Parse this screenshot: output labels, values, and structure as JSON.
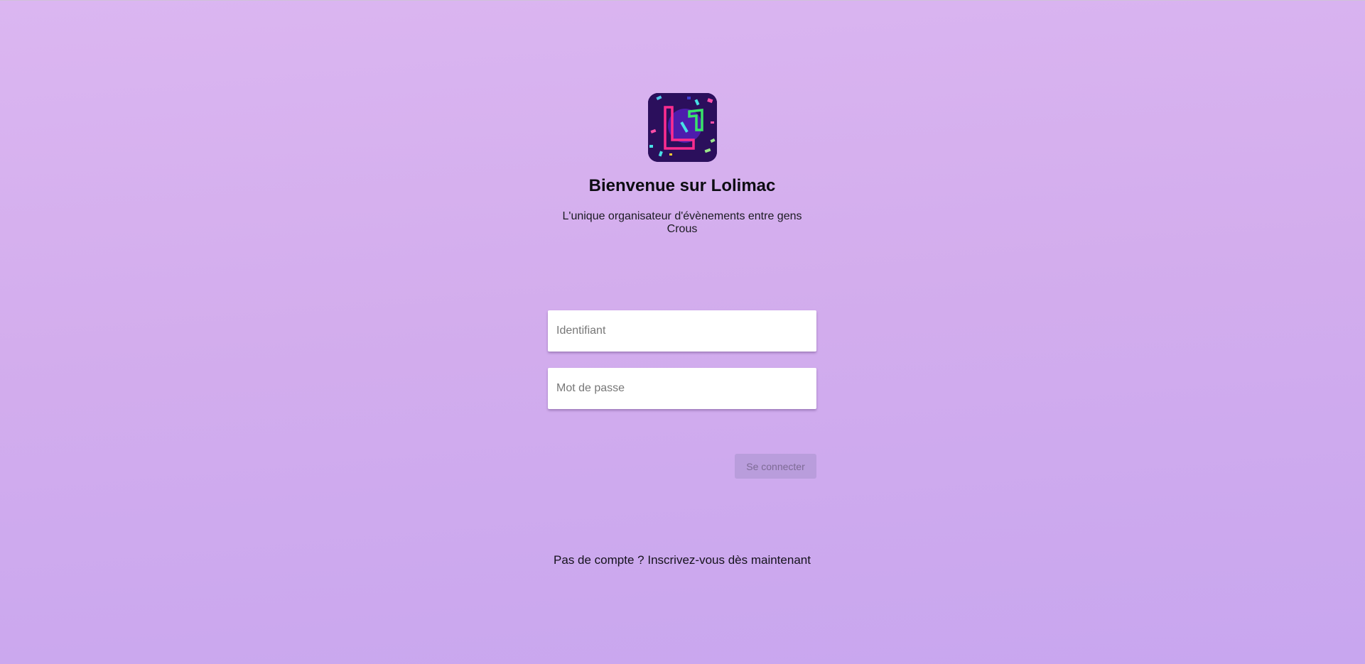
{
  "app": {
    "logo_letters": "L",
    "title": "Bienvenue sur Lolimac",
    "subtitle": "L'unique organisateur d'évènements entre gens Crous"
  },
  "login_form": {
    "username_placeholder": "Identifiant",
    "username_value": "",
    "password_placeholder": "Mot de passe",
    "password_value": "",
    "submit_label": "Se connecter",
    "submit_disabled": true
  },
  "register": {
    "prefix": "Pas de compte ? ",
    "link_label": "Inscrivez-vous dès maintenant"
  },
  "icons": {
    "logo": "lolimac-logo-icon"
  },
  "colors": {
    "background_top": "#dbb6f1",
    "background_bottom": "#c8a6ef",
    "logo_background": "#2b0f5c",
    "logo_pink": "#ff2d8f",
    "logo_green": "#39e36a",
    "button_disabled_bg": "#b99ddc",
    "button_disabled_text": "#7d6a95"
  }
}
